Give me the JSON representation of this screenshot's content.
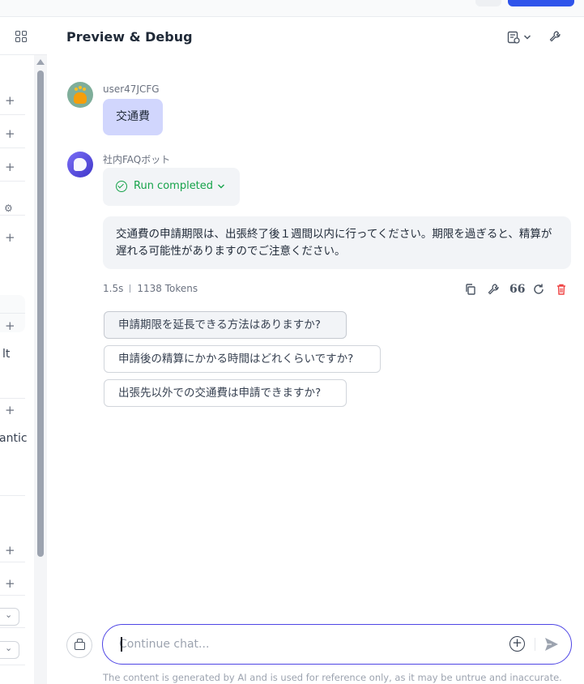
{
  "header": {
    "title": "Preview & Debug",
    "icons": [
      "document-settings-icon",
      "chevron-down-icon",
      "wrench-icon"
    ]
  },
  "left_panel": {
    "fragments": [
      "lt",
      "antic"
    ],
    "icons": [
      "grid-icon",
      "plus-icon",
      "gear-icon",
      "chevron-down-icon"
    ]
  },
  "conversation": {
    "user": {
      "name": "user47JCFG",
      "message": "交通費"
    },
    "bot": {
      "name": "社内FAQボット",
      "run_status": "Run completed",
      "answer": "交通費の申請期限は、出張終了後１週間以内に行ってください。期限を過ぎると、精算が遅れる可能性がありますのでご注意ください。",
      "latency": "1.5s",
      "tokens": "1138 Tokens",
      "actions": [
        "copy-icon",
        "wrench-icon",
        "quote-icon",
        "regenerate-icon",
        "delete-icon"
      ]
    },
    "suggestions": [
      "申請期限を延長できる方法はありますか?",
      "申請後の精算にかかる時間はどれくらいですか?",
      "出張先以外での交通費は申請できますか?"
    ]
  },
  "input": {
    "placeholder": "Continue chat...",
    "value": ""
  },
  "footer": {
    "disclaimer": "The content is generated by AI and is used for reference only, as it may be untrue and inaccurate."
  },
  "colors": {
    "accent": "#4f46e5",
    "primary_button": "#2f54eb",
    "success": "#16a34a",
    "danger": "#ef4444",
    "user_bubble": "#d1d6fd",
    "bot_bubble": "#f2f4f7"
  }
}
